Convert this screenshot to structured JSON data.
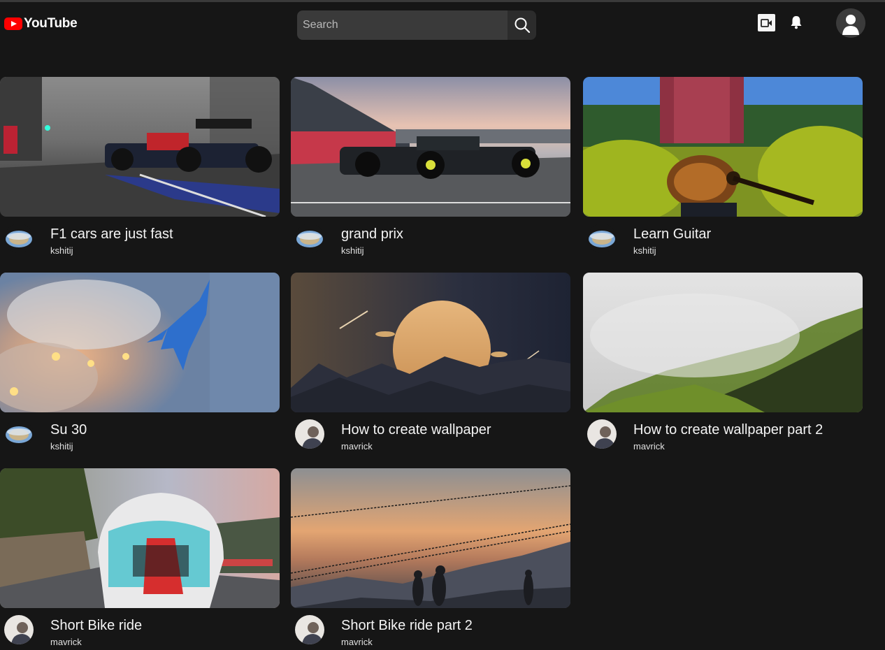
{
  "header": {
    "logo_text": "YouTube",
    "search_placeholder": "Search",
    "icons": [
      "youtube-logo-icon",
      "search-icon",
      "video-camera-icon",
      "bell-icon",
      "profile-icon"
    ]
  },
  "videos": [
    {
      "title": "F1 cars are just fast",
      "channel": "kshitij",
      "avatar": "globe"
    },
    {
      "title": "grand prix",
      "channel": "kshitij",
      "avatar": "globe"
    },
    {
      "title": "Learn Guitar",
      "channel": "kshitij",
      "avatar": "globe"
    },
    {
      "title": "Su 30",
      "channel": "kshitij",
      "avatar": "globe"
    },
    {
      "title": "How to create wallpaper",
      "channel": "mavrick",
      "avatar": "person"
    },
    {
      "title": "How to create wallpaper part 2",
      "channel": "mavrick",
      "avatar": "person"
    },
    {
      "title": "Short Bike ride",
      "channel": "mavrick",
      "avatar": "person"
    },
    {
      "title": "Short Bike ride part 2",
      "channel": "mavrick",
      "avatar": "person"
    }
  ],
  "colors": {
    "background": "#161616",
    "brand": "#ff0000",
    "search_bg": "#3a3a3a"
  }
}
